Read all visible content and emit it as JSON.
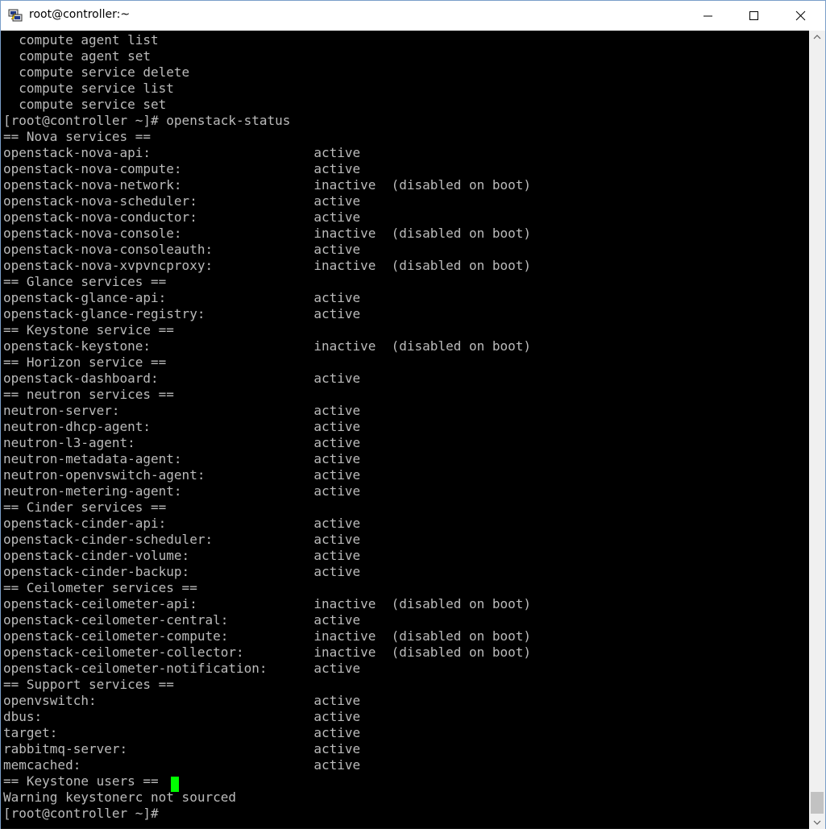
{
  "window": {
    "title": "root@controller:~"
  },
  "terminal": {
    "lines": [
      "  compute agent list",
      "  compute agent set",
      "  compute service delete",
      "  compute service list",
      "  compute service set",
      "[root@controller ~]# openstack-status",
      "== Nova services ==",
      "openstack-nova-api:                     active",
      "openstack-nova-compute:                 active",
      "openstack-nova-network:                 inactive  (disabled on boot)",
      "openstack-nova-scheduler:               active",
      "openstack-nova-conductor:               active",
      "openstack-nova-console:                 inactive  (disabled on boot)",
      "openstack-nova-consoleauth:             active",
      "openstack-nova-xvpvncproxy:             inactive  (disabled on boot)",
      "== Glance services ==",
      "openstack-glance-api:                   active",
      "openstack-glance-registry:              active",
      "== Keystone service ==",
      "openstack-keystone:                     inactive  (disabled on boot)",
      "== Horizon service ==",
      "openstack-dashboard:                    active",
      "== neutron services ==",
      "neutron-server:                         active",
      "neutron-dhcp-agent:                     active",
      "neutron-l3-agent:                       active",
      "neutron-metadata-agent:                 active",
      "neutron-openvswitch-agent:              active",
      "neutron-metering-agent:                 active",
      "== Cinder services ==",
      "openstack-cinder-api:                   active",
      "openstack-cinder-scheduler:             active",
      "openstack-cinder-volume:                active",
      "openstack-cinder-backup:                active",
      "== Ceilometer services ==",
      "openstack-ceilometer-api:               inactive  (disabled on boot)",
      "openstack-ceilometer-central:           active",
      "openstack-ceilometer-compute:           inactive  (disabled on boot)",
      "openstack-ceilometer-collector:         inactive  (disabled on boot)",
      "openstack-ceilometer-notification:      active",
      "== Support services ==",
      "openvswitch:                            active",
      "dbus:                                   active",
      "target:                                 active",
      "rabbitmq-server:                        active",
      "memcached:                              active",
      "== Keystone users ==",
      "Warning keystonerc not sourced",
      "[root@controller ~]# "
    ],
    "cursor_color": "#00ff00",
    "text_color": "#bbbbbb",
    "background_color": "#000000"
  },
  "icons": {
    "app": "putty-icon",
    "minimize": "minimize-icon",
    "maximize": "maximize-icon",
    "close": "close-icon",
    "scroll_up": "scroll-up-arrow-icon",
    "scroll_down": "scroll-down-arrow-icon"
  }
}
